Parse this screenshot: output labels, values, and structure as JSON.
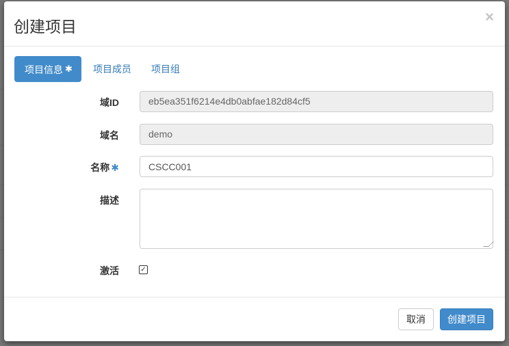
{
  "modal": {
    "title": "创建项目",
    "close_symbol": "×"
  },
  "tabs": [
    {
      "label": "项目信息",
      "required": "✱",
      "active": true
    },
    {
      "label": "项目成员",
      "active": false
    },
    {
      "label": "项目组",
      "active": false
    }
  ],
  "form": {
    "domain_id": {
      "label": "域ID",
      "value": "eb5ea351f6214e4db0abfae182d84cf5",
      "readonly": true
    },
    "domain_name": {
      "label": "域名",
      "value": "demo",
      "readonly": true
    },
    "name": {
      "label": "名称",
      "required": "✱",
      "value": "CSCC001"
    },
    "description": {
      "label": "描述",
      "value": ""
    },
    "enabled": {
      "label": "激活",
      "checked": true,
      "check_symbol": "✓"
    }
  },
  "footer": {
    "cancel_label": "取消",
    "submit_label": "创建项目"
  },
  "colors": {
    "primary": "#428bca",
    "link": "#337ab7",
    "readonly_bg": "#eeeeee",
    "overlay": "#777777"
  }
}
